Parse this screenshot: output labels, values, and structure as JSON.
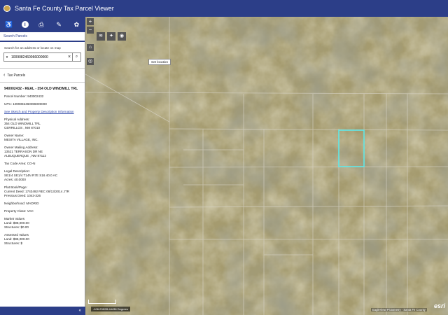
{
  "app": {
    "title": "Santa Fe County Tax Parcel Viewer"
  },
  "toolbar": {
    "icons": [
      "wheelchair-icon",
      "info-icon",
      "print-icon",
      "pencil-icon",
      "globe-icon"
    ]
  },
  "panel": {
    "tab_label": "Search Parcels",
    "search_hint": "Search for an address or locate on map",
    "search_value": "1009082460066000000",
    "crumb_label": "Tax Parcels",
    "parcel_header": "940002432 - REAL - 354 OLD WINDMILL TRL",
    "parcel_number_label": "Parcel Number:",
    "parcel_number": "940002432",
    "upc_label": "UPC:",
    "upc": "1009082460066000000",
    "sketch_link": "See Sketch and Property Description Information",
    "physical_address_label": "Physical Address:",
    "physical_address_1": "354 OLD WINDMILL TRL",
    "physical_address_2": "CERRILLOS , NM  87010",
    "owner_name_label": "Owner Name:",
    "owner_name": "MESITA VILLAGE, INC.",
    "owner_mailing_label": "Owner Mailing Address:",
    "owner_mailing_1": "13521 TERRASON DR NE",
    "owner_mailing_2": "ALBUQUERQUE , NM  87112",
    "tax_code_label": "Tax Code Area:",
    "tax_code": "CO-N",
    "legal_label": "Legal Description:",
    "legal_1": "SE1/4 SE1/4 T14N R7E S16 40.0 AC",
    "legal_2": "Acres:     40.0000",
    "plat_label": "Plat Book/Page:",
    "current_deed": "Current Deed:    1743492 REC 08/13/2014 JTR",
    "previous_deed": "Previous Deed:    1043-326",
    "neighborhood_label": "Neighborhood:",
    "neighborhood": "MADRID",
    "property_class_label": "Property Class:",
    "property_class": "VAC",
    "market_label": "Market Values",
    "market_land": "Land:     $98,000.00",
    "market_structures": "Structures:     $0.00",
    "assessed_label": "Assessed Values",
    "assessed_land": "Land:     $95,000.00",
    "assessed_structures": "Structures:     $"
  },
  "map": {
    "tooltip": "Set location",
    "coords": "-106.235/35.44436 Degrees",
    "attribution": "EagleView Pictometry · Santa Fe County",
    "logo": "esri",
    "selection_color": "#5fe8e8",
    "zoom_in": "+",
    "zoom_out": "−"
  }
}
